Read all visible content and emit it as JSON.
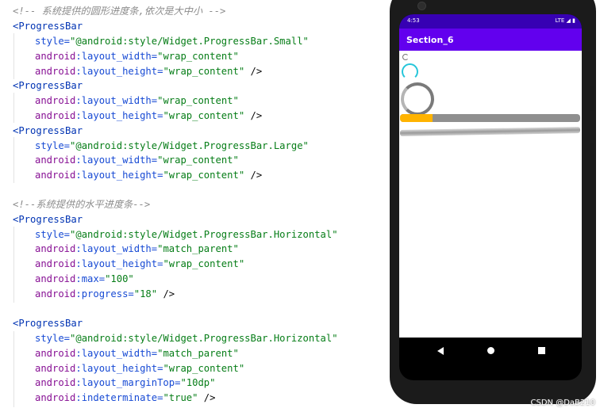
{
  "code": {
    "comment1": "<!-- 系统提供的圆形进度条,依次是大中小 -->",
    "block1": {
      "open": "<ProgressBar",
      "style_attr": "style=",
      "style_val": "\"@android:style/Widget.ProgressBar.Small\"",
      "w_ns": "android",
      "w_attr": ":layout_width=",
      "w_val": "\"wrap_content\"",
      "h_ns": "android",
      "h_attr": ":layout_height=",
      "h_val": "\"wrap_content\"",
      "close": " />"
    },
    "block2": {
      "open": "<ProgressBar",
      "w_ns": "android",
      "w_attr": ":layout_width=",
      "w_val": "\"wrap_content\"",
      "h_ns": "android",
      "h_attr": ":layout_height=",
      "h_val": "\"wrap_content\"",
      "close": " />"
    },
    "block3": {
      "open": "<ProgressBar",
      "style_attr": "style=",
      "style_val": "\"@android:style/Widget.ProgressBar.Large\"",
      "w_ns": "android",
      "w_attr": ":layout_width=",
      "w_val": "\"wrap_content\"",
      "h_ns": "android",
      "h_attr": ":layout_height=",
      "h_val": "\"wrap_content\"",
      "close": " />"
    },
    "comment2": "<!--系统提供的水平进度条-->",
    "block4": {
      "open": "<ProgressBar",
      "style_attr": "style=",
      "style_val": "\"@android:style/Widget.ProgressBar.Horizontal\"",
      "w_ns": "android",
      "w_attr": ":layout_width=",
      "w_val": "\"match_parent\"",
      "h_ns": "android",
      "h_attr": ":layout_height=",
      "h_val": "\"wrap_content\"",
      "max_ns": "android",
      "max_attr": ":max=",
      "max_val": "\"100\"",
      "prog_ns": "android",
      "prog_attr": ":progress=",
      "prog_val": "\"18\"",
      "close": " />"
    },
    "block5": {
      "open": "<ProgressBar",
      "style_attr": "style=",
      "style_val": "\"@android:style/Widget.ProgressBar.Horizontal\"",
      "w_ns": "android",
      "w_attr": ":layout_width=",
      "w_val": "\"match_parent\"",
      "h_ns": "android",
      "h_attr": ":layout_height=",
      "h_val": "\"wrap_content\"",
      "mt_ns": "android",
      "mt_attr": ":layout_marginTop=",
      "mt_val": "\"10dp\"",
      "ind_ns": "android",
      "ind_attr": ":indeterminate=",
      "ind_val": "\"true\"",
      "close": " />"
    }
  },
  "phone": {
    "status_time": "4:53",
    "status_right": "LTE ◢ ▮",
    "app_title": "Section_6",
    "horizontal_progress": 18,
    "horizontal_max": 100,
    "colors": {
      "status_bar": "#3700b3",
      "app_bar": "#6200ee",
      "progress_fill": "#ffb300",
      "spinner_medium": "#26c6da"
    },
    "icons": [
      "back-icon",
      "home-icon",
      "recents-icon"
    ]
  },
  "watermark": "CSDN @DaB210"
}
